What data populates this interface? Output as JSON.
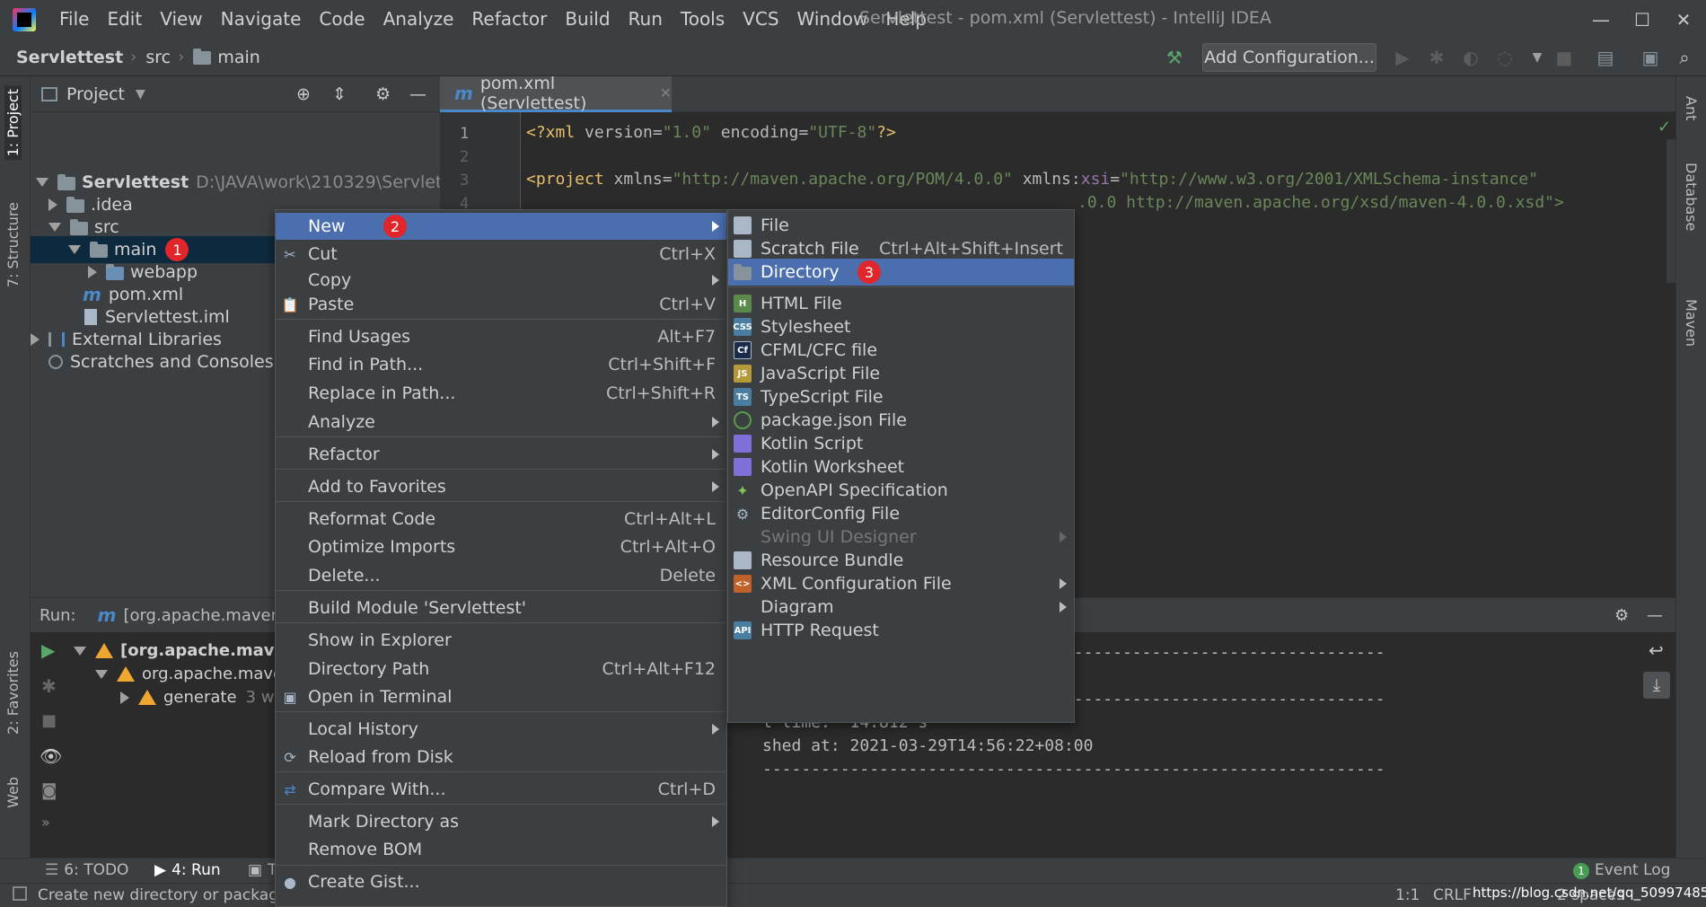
{
  "window": {
    "title": "Servlettest - pom.xml (Servlettest) - IntelliJ IDEA",
    "minimize": "—",
    "maximize": "☐",
    "close": "✕"
  },
  "menubar": [
    "File",
    "Edit",
    "View",
    "Navigate",
    "Code",
    "Analyze",
    "Refactor",
    "Build",
    "Run",
    "Tools",
    "VCS",
    "Window",
    "Help"
  ],
  "breadcrumb": {
    "project": "Servlettest",
    "src": "src",
    "main": "main"
  },
  "toolbar": {
    "add_configuration": "Add Configuration..."
  },
  "left_tools": {
    "project": "1: Project",
    "structure": "7: Structure",
    "favorites": "2: Favorites",
    "web": "Web"
  },
  "right_tools": {
    "ant": "Ant",
    "database": "Database",
    "maven": "Maven"
  },
  "project_panel": {
    "title": "Project",
    "tree": [
      {
        "label": "Servlettest",
        "path": "D:\\JAVA\\work\\210329\\Servlettest"
      },
      {
        "label": ".idea"
      },
      {
        "label": "src"
      },
      {
        "label": "main",
        "badge": "1"
      },
      {
        "label": "webapp"
      },
      {
        "label": "pom.xml"
      },
      {
        "label": "Servlettest.iml"
      },
      {
        "label": "External Libraries"
      },
      {
        "label": "Scratches and Consoles"
      }
    ]
  },
  "editor": {
    "tab": "pom.xml (Servlettest)",
    "line_numbers": [
      "1",
      "2",
      "3",
      "4"
    ],
    "line1": {
      "a": "<?xml ",
      "b": "version",
      "c": "=",
      "d": "\"1.0\"",
      "e": " encoding",
      "f": "=",
      "g": "\"UTF-8\"",
      "h": "?>"
    },
    "line3": {
      "a": "<project ",
      "b": "xmlns",
      "c": "=",
      "d": "\"http://maven.apache.org/POM/4.0.0\"",
      "e": " xmlns:",
      "f": "xsi",
      "g": "=",
      "h": "\"http://www.w3.org/2001/XMLSchema-instance\""
    },
    "line4": ".0.0 http://maven.apache.org/xsd/maven-4.0.0.xsd\">"
  },
  "run_panel": {
    "label": "Run:",
    "tab": "[org.apache.maven.",
    "rows": [
      {
        "label": "[org.apache.maven"
      },
      {
        "label": "org.apache.mave"
      },
      {
        "label": "generate",
        "suffix": "3 w"
      }
    ],
    "console": [
      "----------------------------------------------------------------",
      "----------------------------------------------------------------",
      "l time:  14.812 s",
      "shed at: 2021-03-29T14:56:22+08:00",
      "----------------------------------------------------------------"
    ]
  },
  "bottom_tabs": {
    "todo": "6: TODO",
    "run": "4: Run",
    "terminal": "T",
    "event_log": "Event Log",
    "event_count": "1"
  },
  "statusbar": {
    "message": "Create new directory or packag",
    "position": "1:1",
    "line_sep": "CRLF",
    "watermark": "https://blog.csdn.net/qq_50997485",
    "spaces": "2 spaces"
  },
  "context_menu": [
    {
      "label": "New",
      "badge": "2",
      "arrow": true
    },
    {
      "label": "Cut",
      "shortcut": "Ctrl+X"
    },
    {
      "label": "Copy",
      "arrow": true
    },
    {
      "label": "Paste",
      "shortcut": "Ctrl+V"
    },
    {
      "label": "Find Usages",
      "shortcut": "Alt+F7"
    },
    {
      "label": "Find in Path...",
      "shortcut": "Ctrl+Shift+F"
    },
    {
      "label": "Replace in Path...",
      "shortcut": "Ctrl+Shift+R"
    },
    {
      "label": "Analyze",
      "arrow": true
    },
    {
      "label": "Refactor",
      "arrow": true
    },
    {
      "label": "Add to Favorites",
      "arrow": true
    },
    {
      "label": "Reformat Code",
      "shortcut": "Ctrl+Alt+L"
    },
    {
      "label": "Optimize Imports",
      "shortcut": "Ctrl+Alt+O"
    },
    {
      "label": "Delete...",
      "shortcut": "Delete"
    },
    {
      "label": "Build Module 'Servlettest'"
    },
    {
      "label": "Show in Explorer"
    },
    {
      "label": "Directory Path",
      "shortcut": "Ctrl+Alt+F12"
    },
    {
      "label": "Open in Terminal"
    },
    {
      "label": "Local History",
      "arrow": true
    },
    {
      "label": "Reload from Disk"
    },
    {
      "label": "Compare With...",
      "shortcut": "Ctrl+D"
    },
    {
      "label": "Mark Directory as",
      "arrow": true
    },
    {
      "label": "Remove BOM"
    },
    {
      "label": "Create Gist..."
    }
  ],
  "submenu": [
    {
      "label": "File"
    },
    {
      "label": "Scratch File",
      "shortcut": "Ctrl+Alt+Shift+Insert"
    },
    {
      "label": "Directory",
      "badge": "3"
    },
    {
      "label": "HTML File"
    },
    {
      "label": "Stylesheet"
    },
    {
      "label": "CFML/CFC file"
    },
    {
      "label": "JavaScript File"
    },
    {
      "label": "TypeScript File"
    },
    {
      "label": "package.json File"
    },
    {
      "label": "Kotlin Script"
    },
    {
      "label": "Kotlin Worksheet"
    },
    {
      "label": "OpenAPI Specification"
    },
    {
      "label": "EditorConfig File"
    },
    {
      "label": "Swing UI Designer"
    },
    {
      "label": "Resource Bundle"
    },
    {
      "label": "XML Configuration File"
    },
    {
      "label": "Diagram"
    },
    {
      "label": "HTTP Request"
    }
  ],
  "colors": {
    "accent": "#4b6eaf",
    "badge": "#e0262a",
    "panel": "#3c3f41",
    "editor": "#2b2b2b"
  }
}
